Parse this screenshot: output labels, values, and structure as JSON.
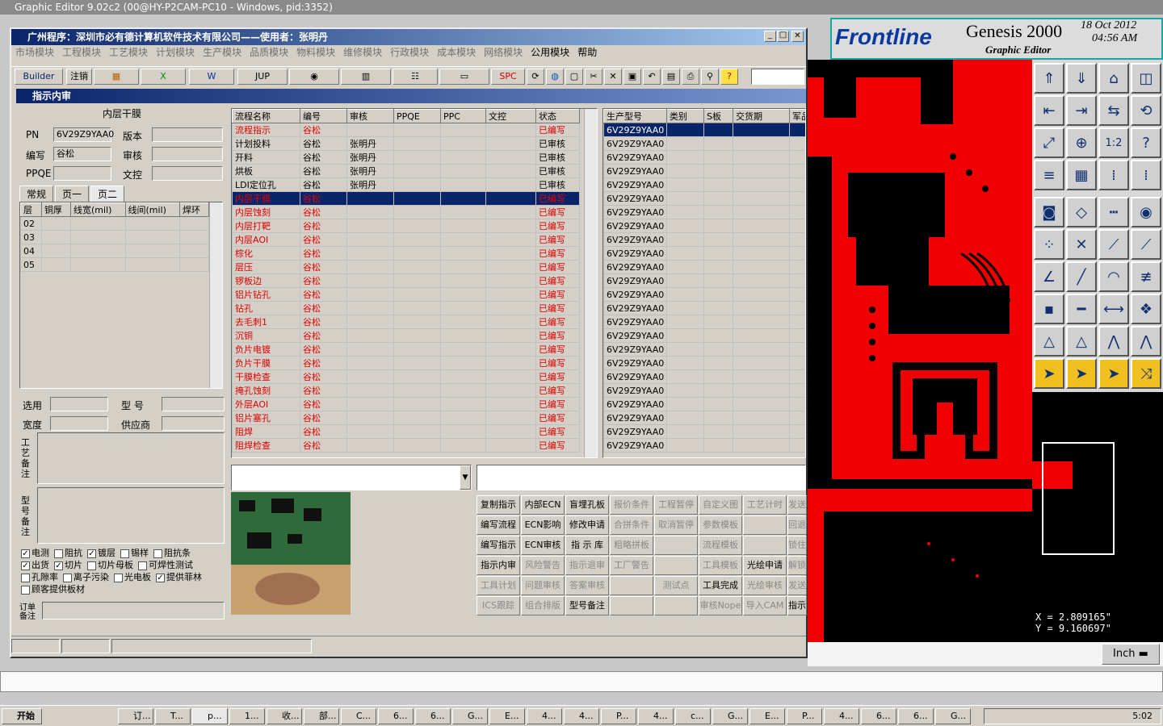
{
  "app_title": "Graphic Editor 9.02c2 (00@HY-P2CAM-PC10 - Windows, pid:3352)",
  "genesis": {
    "brand": "Frontline",
    "product": "Genesis 2000",
    "sub": "Graphic Editor",
    "date": "18 Oct 2012",
    "time": "04:56 AM",
    "x": "X = 2.809165\"",
    "y": "Y = 9.160697\"",
    "unit": "Inch",
    "tool_icons": [
      "layer-up-icon",
      "layer-down-icon",
      "home-icon",
      "split-window-icon",
      "import-icon",
      "export-icon",
      "swap-icon",
      "step-icon",
      "fit-icon",
      "zoom-icon",
      "scale-icon",
      "help-icon",
      "tools-icon",
      "grid-icon",
      "snap-icon",
      "snap-alt-icon",
      "fill-icon",
      "outline-icon",
      "ruler-icon",
      "pad-icon",
      "net-icon",
      "cross-icon",
      "line-icon",
      "route-icon",
      "angle-icon",
      "slash-icon",
      "arc-icon",
      "mirror-icon",
      "measure-icon",
      "minus-icon",
      "distance-icon",
      "group-icon",
      "warn-icon",
      "chevron-icon",
      "arch-icon",
      "arch-alt-icon",
      "pointer-icon",
      "select-icon",
      "highlight-icon",
      "move-icon"
    ]
  },
  "main": {
    "title": "广州程序：深圳市必有德计算机软件技术有限公司——使用者：张明丹",
    "menu": [
      "市场模块",
      "工程模块",
      "工艺模块",
      "计划模块",
      "生产模块",
      "品质模块",
      "物料模块",
      "维修模块",
      "行政模块",
      "成本模块",
      "网络模块",
      "公用模块",
      "帮助"
    ],
    "toolbar": {
      "builder": "Builder",
      "logout": "注销",
      "jup": "JUP",
      "spc": "SPC"
    },
    "sub_title": "指示内审",
    "left": {
      "section": "内层干膜",
      "pn_label": "PN",
      "pn": "6V29Z9YAA0",
      "ver_label": "版本",
      "author_label": "编写",
      "author": "谷松",
      "review_label": "审核",
      "ppqe_label": "PPQE",
      "doc_label": "文控",
      "tabs": [
        "常规",
        "页一",
        "页二"
      ],
      "layer_cols": [
        "层",
        "铜厚",
        "线宽(mil)",
        "线间(mil)",
        "焊环"
      ],
      "layers": [
        "02",
        "03",
        "04",
        "05"
      ],
      "select_label": "选用",
      "model_label": "型  号",
      "width_label": "宽度",
      "supplier_label": "供应商",
      "craft_note": "工艺备注",
      "type_note": "型号备注",
      "order_note": "订单备注",
      "checks": [
        [
          "电测",
          true
        ],
        [
          "阻抗",
          false
        ],
        [
          "镀层",
          true
        ],
        [
          "锡样",
          false
        ],
        [
          "阻抗条",
          false
        ],
        [
          "出货",
          true
        ],
        [
          "切片",
          true
        ],
        [
          "切片母板",
          false
        ],
        [
          "可焊性测试",
          false
        ],
        [
          "孔隙率",
          false
        ],
        [
          "离子污染",
          false
        ],
        [
          "光电板",
          false
        ],
        [
          "提供菲林",
          true
        ],
        [
          "顾客提供板材",
          false
        ]
      ]
    },
    "flow_cols": [
      "流程名称",
      "编号",
      "审核",
      "PPQE",
      "PPC",
      "文控",
      "状态"
    ],
    "flows": [
      [
        "流程指示",
        "谷松",
        "",
        "已编写"
      ],
      [
        "计划投料",
        "谷松",
        "张明丹",
        "已审核"
      ],
      [
        "开料",
        "谷松",
        "张明丹",
        "已审核"
      ],
      [
        "烘板",
        "谷松",
        "张明丹",
        "已审核"
      ],
      [
        "LDI定位孔",
        "谷松",
        "张明丹",
        "已审核"
      ],
      [
        "内层干膜",
        "谷松",
        "",
        "已编写"
      ],
      [
        "内层蚀刻",
        "谷松",
        "",
        "已编写"
      ],
      [
        "内层打靶",
        "谷松",
        "",
        "已编写"
      ],
      [
        "内层AOI",
        "谷松",
        "",
        "已编写"
      ],
      [
        "棕化",
        "谷松",
        "",
        "已编写"
      ],
      [
        "层压",
        "谷松",
        "",
        "已编写"
      ],
      [
        "锣板边",
        "谷松",
        "",
        "已编写"
      ],
      [
        "铝片钻孔",
        "谷松",
        "",
        "已编写"
      ],
      [
        "钻孔",
        "谷松",
        "",
        "已编写"
      ],
      [
        "去毛刺1",
        "谷松",
        "",
        "已编写"
      ],
      [
        "沉铜",
        "谷松",
        "",
        "已编写"
      ],
      [
        "负片电镀",
        "谷松",
        "",
        "已编写"
      ],
      [
        "负片干膜",
        "谷松",
        "",
        "已编写"
      ],
      [
        "干膜检查",
        "谷松",
        "",
        "已编写"
      ],
      [
        "掩孔蚀刻",
        "谷松",
        "",
        "已编写"
      ],
      [
        "外层AOI",
        "谷松",
        "",
        "已编写"
      ],
      [
        "铝片塞孔",
        "谷松",
        "",
        "已编写"
      ],
      [
        "阻焊",
        "谷松",
        "",
        "已编写"
      ],
      [
        "阻焊检查",
        "谷松",
        "",
        "已编写"
      ]
    ],
    "model_cols": [
      "生产型号",
      "类别",
      "S板",
      "交货期",
      "军品"
    ],
    "model_row": "6V29Z9YAA0",
    "actions": [
      [
        "复制指示",
        1
      ],
      [
        "内部ECN",
        1
      ],
      [
        "盲埋孔板",
        1
      ],
      [
        "报价条件",
        0
      ],
      [
        "工程暂停",
        0
      ],
      [
        "自定义图",
        0
      ],
      [
        "工艺计时",
        0
      ],
      [
        "发送",
        0
      ],
      [
        "编写流程",
        1
      ],
      [
        "ECN影响",
        1
      ],
      [
        "修改申请",
        1
      ],
      [
        "合拼条件",
        0
      ],
      [
        "取消暂停",
        0
      ],
      [
        "参数模板",
        0
      ],
      [
        "",
        0
      ],
      [
        "回退",
        0
      ],
      [
        "编写指示",
        1
      ],
      [
        "ECN审核",
        1
      ],
      [
        "指 示 库",
        1
      ],
      [
        "粗略拼板",
        0
      ],
      [
        "",
        0
      ],
      [
        "流程模板",
        0
      ],
      [
        "",
        0
      ],
      [
        "锁住",
        0
      ],
      [
        "指示内审",
        1
      ],
      [
        "风险警告",
        0
      ],
      [
        "指示退审",
        0
      ],
      [
        "工厂警告",
        0
      ],
      [
        "",
        0
      ],
      [
        "工具模板",
        0
      ],
      [
        "光绘申请",
        1
      ],
      [
        "解锁",
        0
      ],
      [
        "工具计划",
        0
      ],
      [
        "问题审核",
        0
      ],
      [
        "答案审核",
        0
      ],
      [
        "",
        0
      ],
      [
        "测试点",
        0
      ],
      [
        "工具完成",
        1
      ],
      [
        "光绘审核",
        0
      ],
      [
        "发送",
        0
      ],
      [
        "ICS跟踪",
        0
      ],
      [
        "组合排版",
        0
      ],
      [
        "型号备注",
        1
      ],
      [
        "",
        0
      ],
      [
        "",
        0
      ],
      [
        "审核Nope",
        0
      ],
      [
        "导入CAM",
        0
      ],
      [
        "指示",
        1
      ]
    ]
  },
  "taskbar": {
    "start": "开始",
    "clock": "5:02",
    "items": [
      "订...",
      "T...",
      "p...",
      "1...",
      "收...",
      "部...",
      "C...",
      "6...",
      "6...",
      "G...",
      "E...",
      "4...",
      "4...",
      "P...",
      "4...",
      "c...",
      "G...",
      "E...",
      "P...",
      "4...",
      "6...",
      "6...",
      "G..."
    ]
  }
}
